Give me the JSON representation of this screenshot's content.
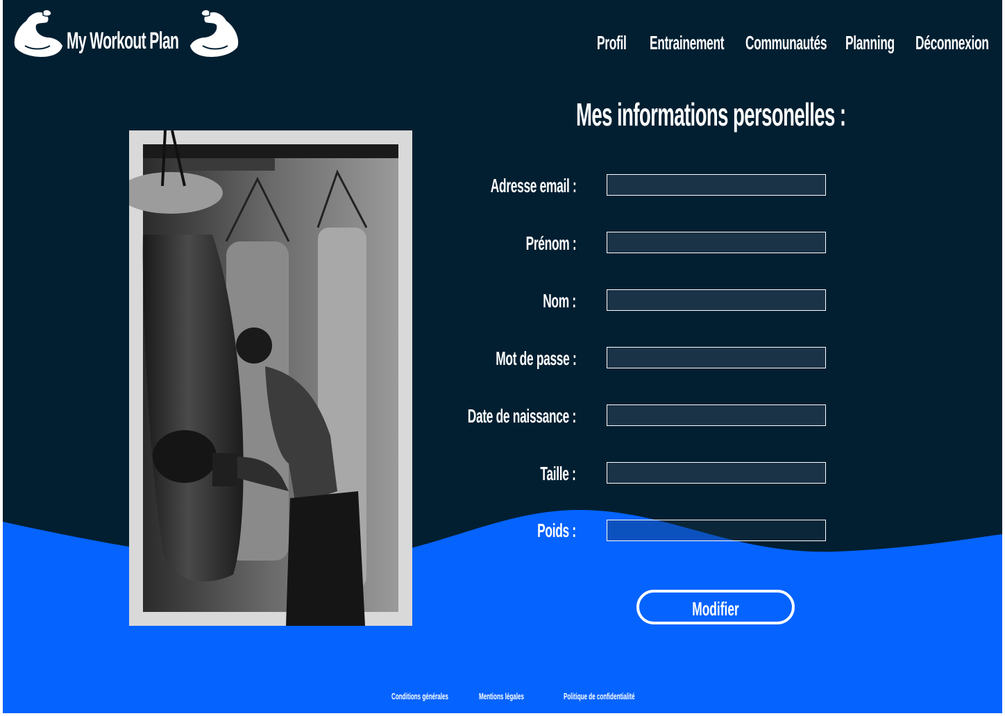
{
  "brand": {
    "name": "My Workout Plan",
    "logo_icon": "flexed-arm-icon"
  },
  "nav": {
    "items": [
      {
        "label": "Profil"
      },
      {
        "label": "Entrainement"
      },
      {
        "label": "Communautés"
      },
      {
        "label": "Planning"
      },
      {
        "label": "Déconnexion"
      }
    ]
  },
  "form": {
    "title": "Mes informations personelles :",
    "fields": [
      {
        "label": "Adresse email :",
        "value": ""
      },
      {
        "label": "Prénom :",
        "value": ""
      },
      {
        "label": "Nom :",
        "value": ""
      },
      {
        "label": "Mot de passe :",
        "value": ""
      },
      {
        "label": "Date de naissance :",
        "value": ""
      },
      {
        "label": "Taille :",
        "value": ""
      },
      {
        "label": "Poids :",
        "value": ""
      }
    ],
    "submit_label": "Modifier"
  },
  "photo": {
    "subject": "boxer-leaning-on-punching-bag-image"
  },
  "footer": {
    "links": [
      {
        "label": "Conditions générales"
      },
      {
        "label": "Mentions légales"
      },
      {
        "label": "Politique de confidentialité"
      }
    ]
  },
  "colors": {
    "background": "#021f31",
    "accent": "#0563ff",
    "field_bg": "#1b3347",
    "text": "#ffffff"
  }
}
